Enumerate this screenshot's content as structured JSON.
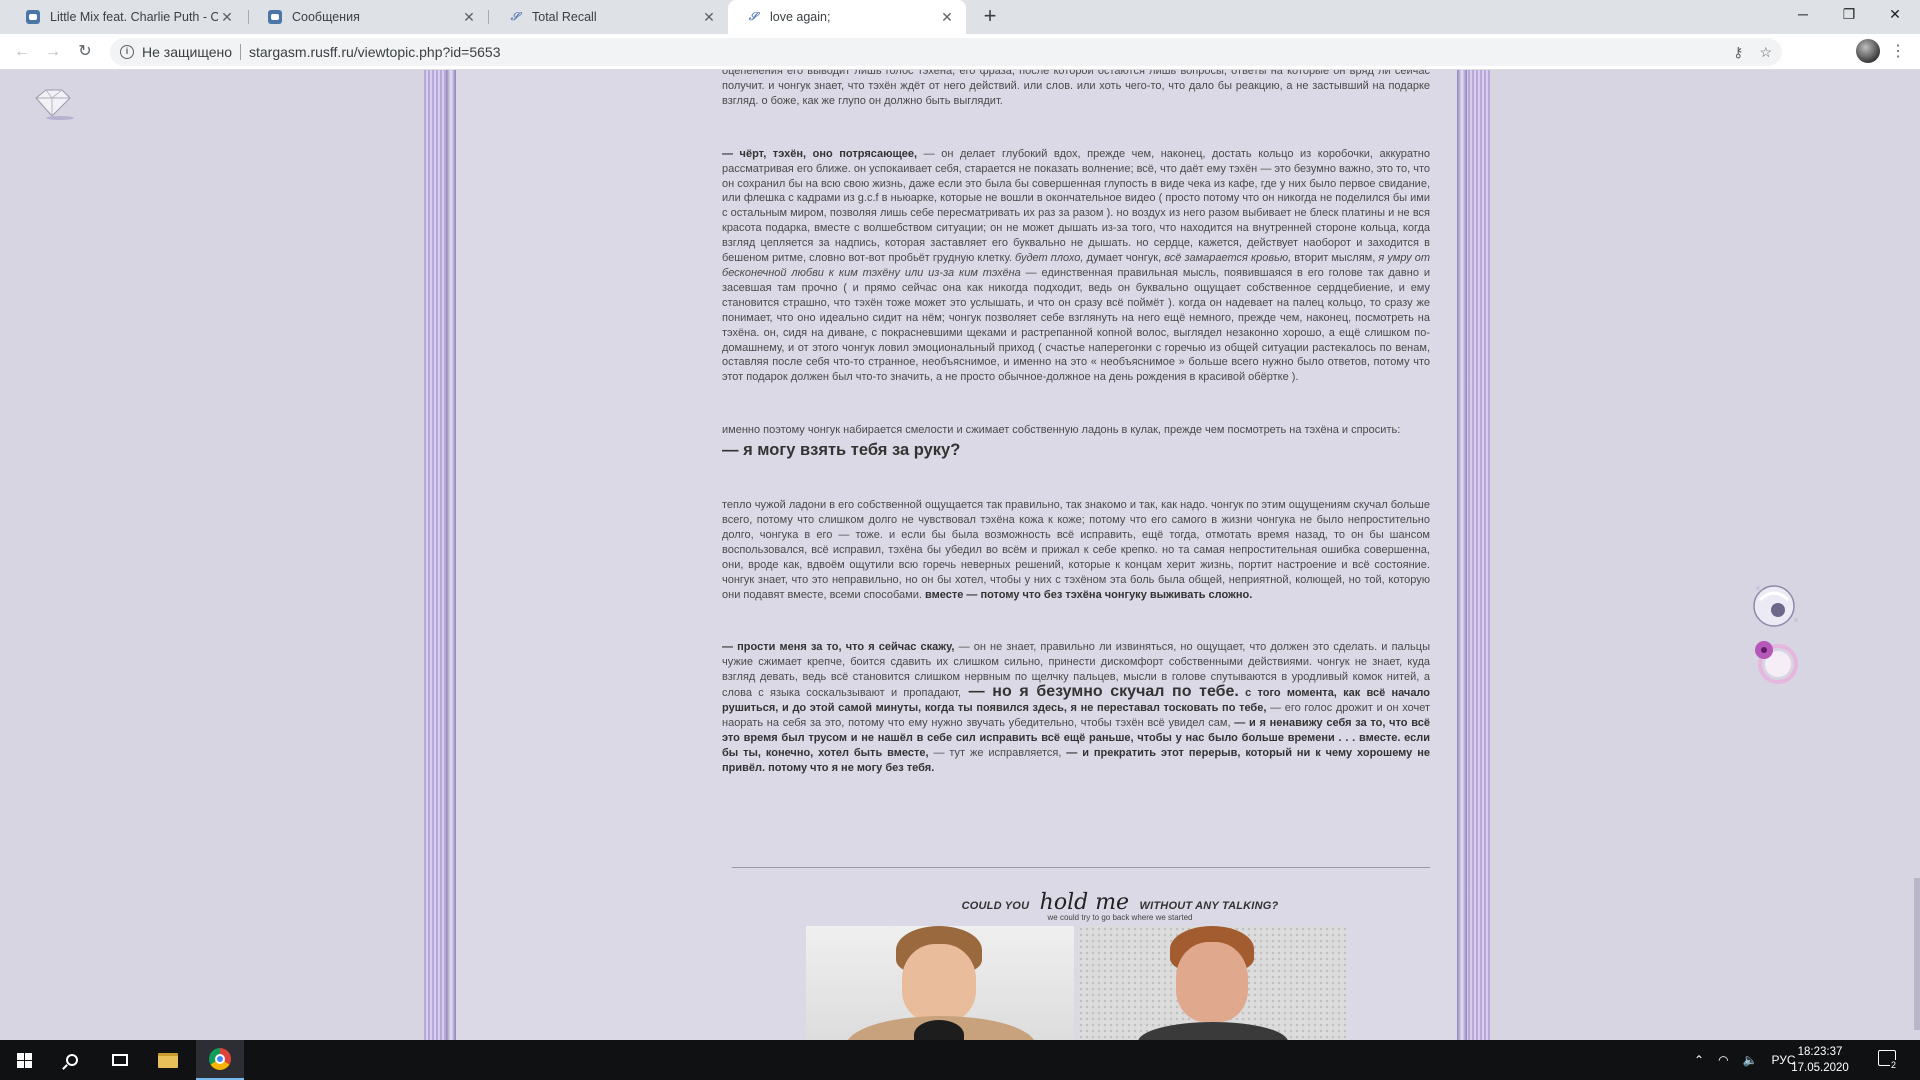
{
  "browser": {
    "tabs": [
      {
        "title": "Little Mix feat. Charlie Puth - Oop",
        "favicon": "vk-icon"
      },
      {
        "title": "Сообщения",
        "favicon": "vk-icon"
      },
      {
        "title": "Total Recall",
        "favicon": "rusff-icon"
      },
      {
        "title": "love again;",
        "favicon": "rusff-icon",
        "active": true
      }
    ],
    "security_label": "Не защищено",
    "url": "stargasm.rusff.ru/viewtopic.php?id=5653"
  },
  "post": {
    "p0": "оцепенения его выводит лишь голос тэхёна, его фраза, после которой остаются лишь вопросы, ответы на которые он вряд ли сейчас получит. и чонгук знает, что тэхён ждёт от него действий. или слов. или хоть чего-то, что дало бы реакцию, а не застывший на подарке взгляд. о боже, как же глупо он должно быть выглядит.",
    "p1_speech": "— чёрт, тэхён, оно потрясающее,",
    "p1_a": " — он делает глубокий вдох, прежде чем, наконец, достать кольцо из коробочки, аккуратно рассматривая его ближе. он успокаивает себя, старается не показать волнение; всё, что даёт ему тэхён — это безумно важно, это то, что он сохранил бы на всю свою жизнь, даже если это была бы совершенная глупость в виде чека из кафе, где у них было первое свидание, или флешка с кадрами из g.c.f в ньюарке, которые не вошли в окончательное видео ( просто потому что он никогда не поделился бы ими с остальным миром, позволяя лишь себе пересматривать их раз за разом ). но воздух из него разом выбивает не блеск платины и не вся красота подарка, вместе с волшебством ситуации; он не может дышать из-за того, что находится на внутренней стороне кольца, когда взгляд цепляется за надпись, которая заставляет его буквально не дышать. но сердце, кажется, действует наоборот и заходится в бешеном ритме, словно вот-вот пробьёт грудную клетку. ",
    "p1_italic1": "будет плохо,",
    "p1_b": " думает чонгук, ",
    "p1_italic2": "всё замарается кровью,",
    "p1_c": " вторит мыслям, ",
    "p1_italic3": "я умру от бесконечной любви к ким тэхёну или из-за ким тэхёна",
    "p1_d": " — единственная правильная мысль, появившаяся в его голове так давно и засевшая там прочно ( и прямо сейчас она как никогда подходит, ведь он буквально ощущает собственное сердцебиение, и ему становится страшно, что тэхён тоже может это услышать, и что он сразу всё поймёт ). когда он надевает на палец кольцо, то сразу же понимает, что оно идеально сидит на нём; чонгук позволяет себе взглянуть на него ещё немного, прежде чем, наконец, посмотреть на тэхёна. он, сидя на диване, с покрасневшими щеками и растрепанной копной волос, выглядел незаконно хорошо, а ещё слишком по-домашнему, и от этого чонгук ловил эмоциональный приход ( счастье наперегонки с горечью из общей ситуации растекалось по венам, оставляя после себя что-то странное, необъяснимое, и именно на это « необъяснимое » больше всего нужно было ответов, потому что этот подарок должен был что-то значить, а не просто обычное-должное на день рождения в красивой обёртке ).",
    "p2": "именно поэтому чонгук набирается смелости и сжимает собственную ладонь в кулак, прежде чем посмотреть на тэхёна и спросить:",
    "p2_question": "— я могу взять тебя за руку?",
    "p3": "тепло чужой ладони в его собственной ощущается так правильно, так знакомо и так, как надо. чонгук по этим ощущениям скучал больше всего, потому что слишком долго не чувствовал тэхёна кожа к коже; потому что его самого в жизни чонгука не было непростительно долго, чонгука в его — тоже. и если бы была возможность всё исправить, ещё тогда, отмотать время назад, то он бы шансом воспользовался, всё исправил, тэхёна бы убедил во всём и прижал к себе крепко. но та самая непростительная ошибка совершенна, они, вроде как, вдвоём ощутили всю горечь неверных решений, которые к концам херит жизнь, портит настроение и всё состояние. чонгук знает, что это неправильно, но он бы хотел, чтобы у них с тэхёном эта боль была общей, неприятной, колющей, но той, которую они подавят вместе, всеми способами.",
    "p3_bold": " вместе — потому что без тэхёна чонгуку выживать сложно.",
    "p4_speech": "— прости меня за то, что я сейчас скажу,",
    "p4_a": " — он не знает, правильно ли извиняться, но ощущает, что должен это сделать. и пальцы чужие сжимает  крепче, боится сдавить их слишком сильно, принести дискомфорт собственными действиями. чонгук не знает, куда взгляд девать, ведь всё становится слишком нервным по щелчку пальцев, мысли в голове спутываются в уродливый комок нитей, а слова с языка соскальзывают и пропадают,",
    "p4_big": " — но я безумно скучал по тебе.",
    "p4_b": " с того момента, как всё начало рушиться, и до этой самой минуты, когда ты появился здесь, я не переставал тосковать по тебе,",
    "p4_c": " — его голос дрожит и он хочет наорать на себя за это, потому что ему нужно звучать убедительно, чтобы тэхён всё увидел сам, ",
    "p4_d": "— и я ненавижу себя за то, что всё это время был трусом и не нашёл в себе сил исправить всё ещё раньше, чтобы у нас было больше времени . . . вместе. если бы ты, конечно, хотел быть вместе,",
    "p4_e": " — тут же исправляется, ",
    "p4_f": "— и прекратить этот перерыв, который ни к чему хорошему не привёл. потому что я не могу без тебя.",
    "caption_pre": "COULD YOU",
    "caption_script": "hold me",
    "caption_post": "WITHOUT ANY TALKING?",
    "caption_sub": "we could try to go back where we started"
  },
  "taskbar": {
    "lang": "РУС",
    "time": "18:23:37",
    "date": "17.05.2020",
    "notifications": "2"
  }
}
